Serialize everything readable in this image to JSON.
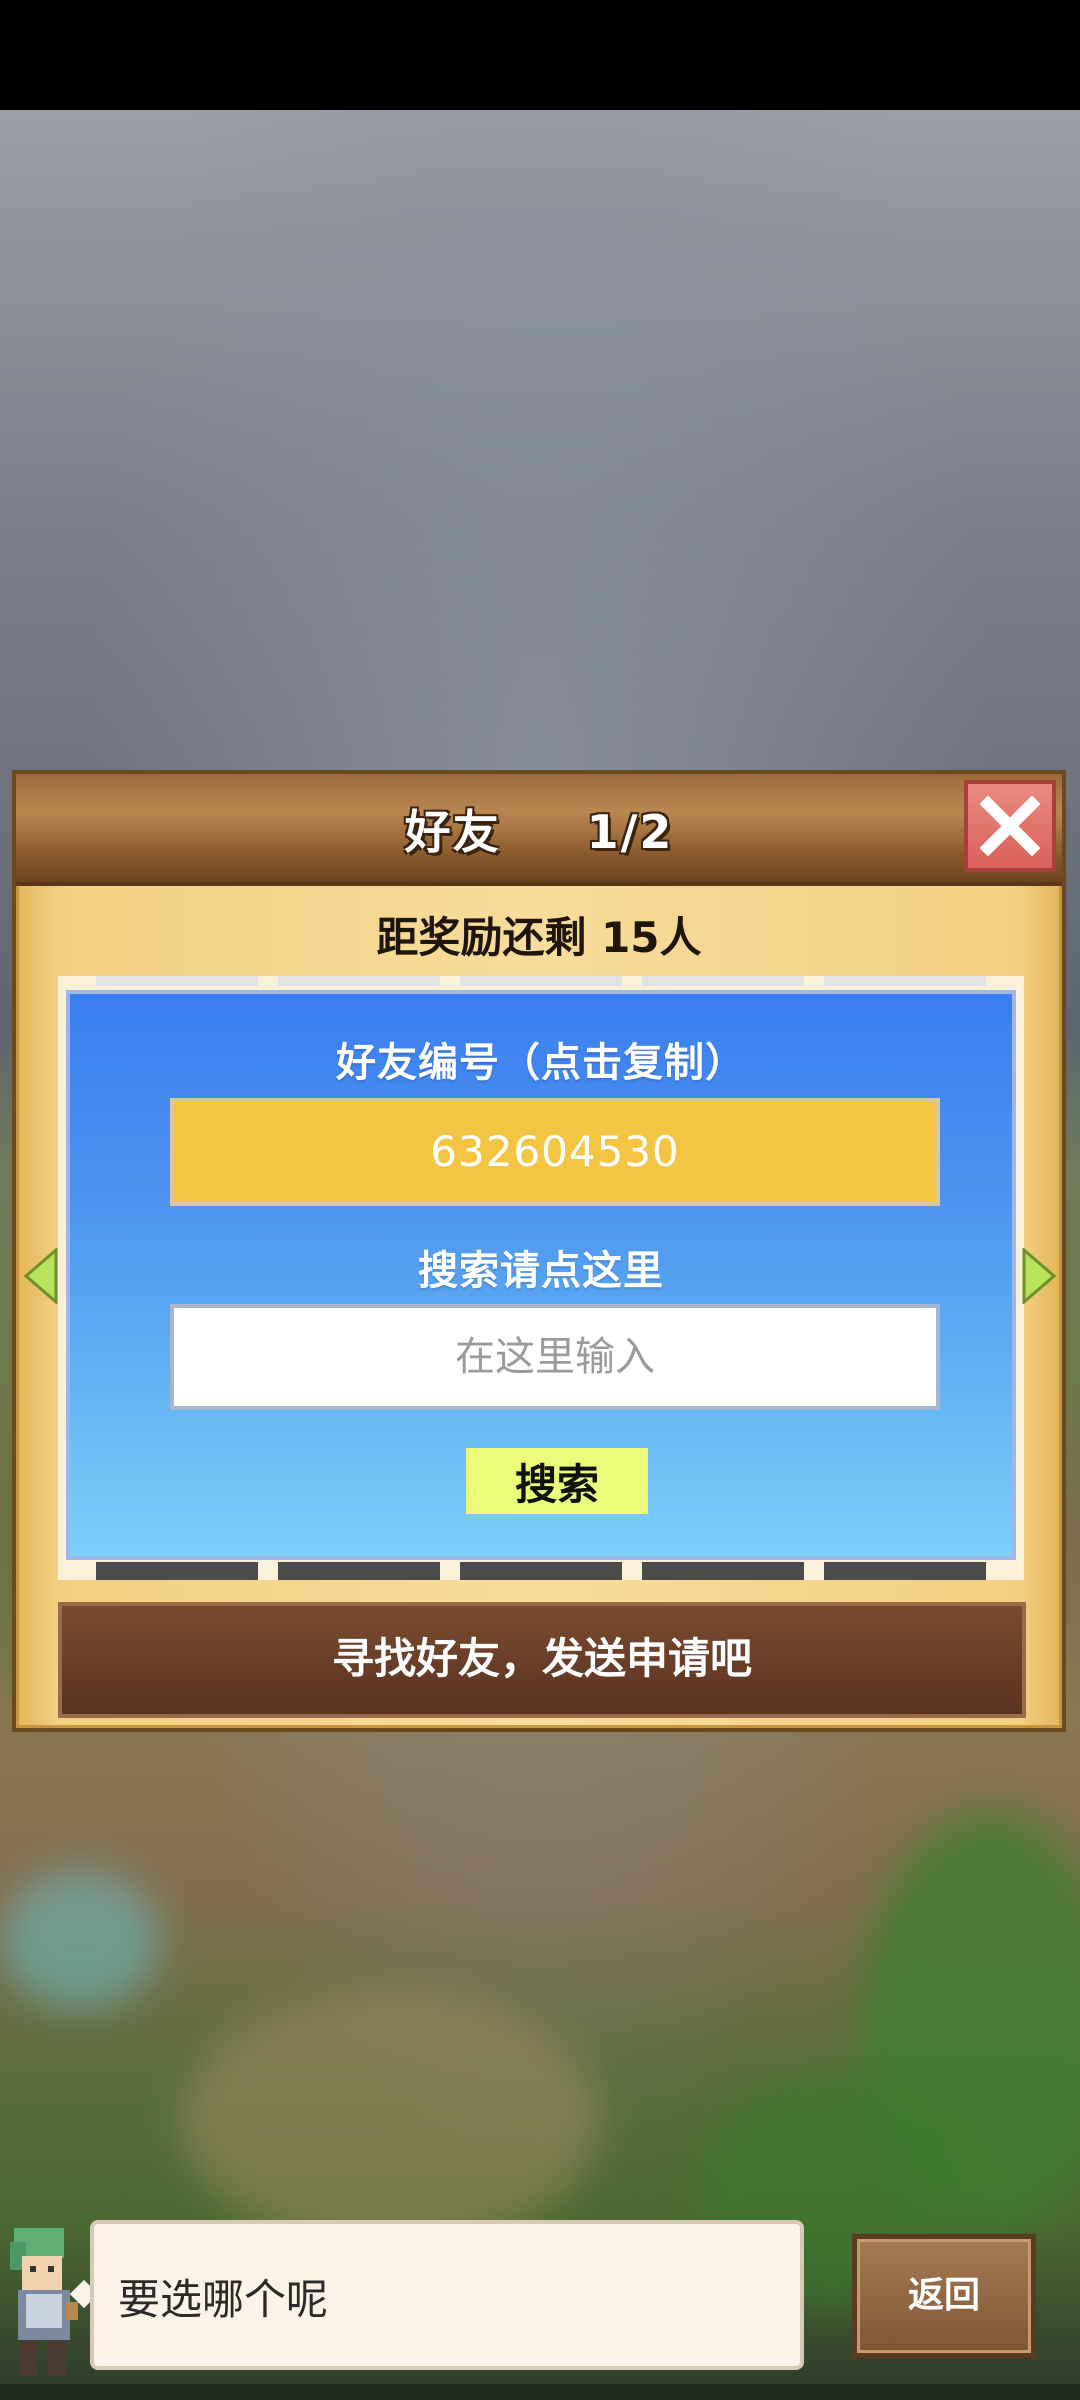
{
  "dialog": {
    "title": "好友",
    "page": "1/2",
    "reward_text": "距奖励还剩 15人",
    "id_label": "好友编号（点击复制）",
    "id_value": "632604530",
    "search_label": "搜索请点这里",
    "search_placeholder": "在这里输入",
    "search_button": "搜索",
    "bottom_button": "寻找好友，发送申请吧"
  },
  "footer": {
    "speech_text": "要选哪个呢",
    "back_button": "返回"
  },
  "icons": {
    "close": "close-icon",
    "prev": "arrow-left-icon",
    "next": "arrow-right-icon"
  },
  "colors": {
    "id_field": "#f4c542",
    "search_button": "#eafc7a",
    "panel": "#4c93f0",
    "close_button": "#d9605a"
  }
}
